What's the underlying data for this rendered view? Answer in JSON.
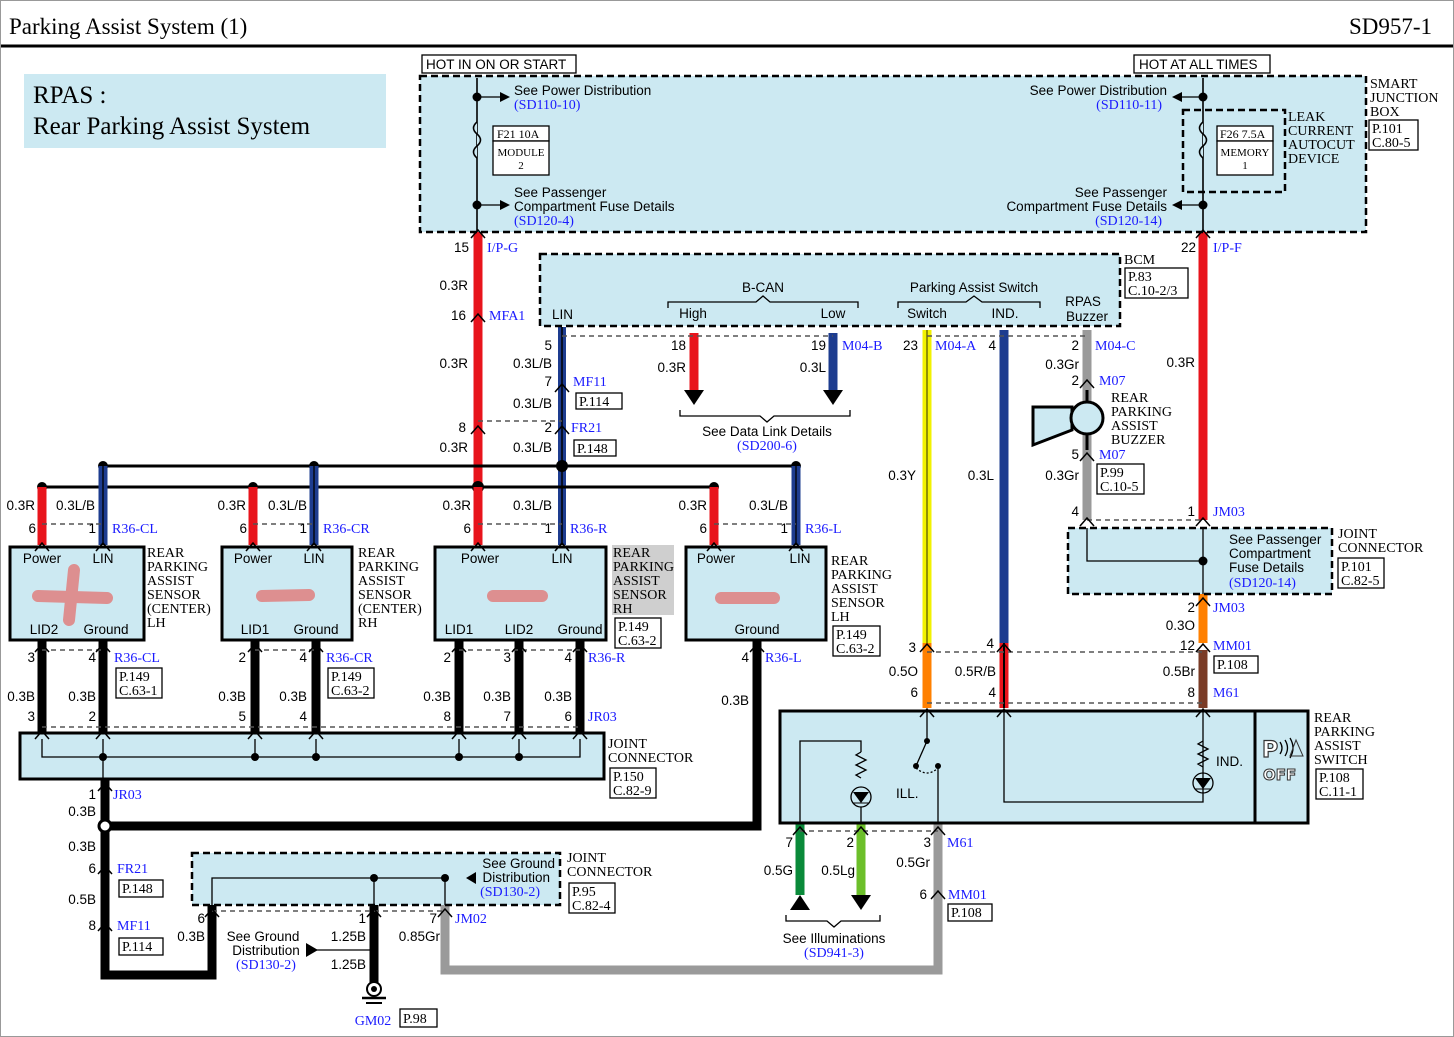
{
  "header": {
    "title": "Parking Assist System (1)",
    "code": "SD957-1"
  },
  "rpas": {
    "line1": "RPAS :",
    "line2": "Rear Parking Assist System"
  },
  "colors": {
    "red": "#e8141c",
    "blue": "#1d3c8f",
    "yellow": "#f2f200",
    "orange": "#ff8000",
    "brown": "#7a3b26",
    "gray": "#9a9a9a",
    "green": "#0a8a3a",
    "light_green": "#6cbf2a",
    "panel": "#cce9f2",
    "connector_text": "#1a1aff"
  },
  "sjb": {
    "hot_ign": "HOT IN ON OR START",
    "hot_all": "HOT AT ALL TIMES",
    "name": [
      "SMART",
      "JUNCTION",
      "BOX"
    ],
    "page": "P.101",
    "conn": "C.80-5",
    "leak": [
      "LEAK",
      "CURRENT",
      "AUTOCUT",
      "DEVICE"
    ],
    "f21": {
      "fuse": "F21 10A",
      "name1": "MODULE",
      "name2": "2"
    },
    "f26": {
      "fuse": "F26 7.5A",
      "name1": "MEMORY",
      "name2": "1"
    },
    "pd_left": "See Power Distribution",
    "pd_left_ref": "(SD110-10)",
    "pd_right": "See Power Distribution",
    "pd_right_ref": "(SD110-11)",
    "pcf_left": [
      "See Passenger",
      "Compartment Fuse Details",
      "(SD120-4)"
    ],
    "pcf_right": [
      "See Passenger",
      "Compartment Fuse Details",
      "(SD120-14)"
    ],
    "pin_left": "15",
    "conn_left": "I/P-G",
    "pin_right": "22",
    "conn_right": "I/P-F"
  },
  "bcm": {
    "name": "BCM",
    "page": "P.83",
    "conn": "C.10-2/3",
    "bcan": "B-CAN",
    "high": "High",
    "low": "Low",
    "lin": "LIN",
    "pas": "Parking Assist Switch",
    "switch": "Switch",
    "ind": "IND.",
    "rpas1": "RPAS",
    "rpas2": "Buzzer"
  },
  "red_main": {
    "w1": "0.3R",
    "p16": "16",
    "c16": "MFA1",
    "w2": "0.3R",
    "p8": "8",
    "w3": "0.3R"
  },
  "lin_main": {
    "p5": "5",
    "w1": "0.3L/B",
    "p7": "7",
    "c7": "MF11",
    "pg7": "P.114",
    "w2": "0.3L/B",
    "p2": "2",
    "c2": "FR21",
    "pg2": "P.148",
    "w3": "0.3L/B"
  },
  "datalink": {
    "p18": "18",
    "p19": "19",
    "conn": "M04-B",
    "w18": "0.3R",
    "w19": "0.3L",
    "text": "See Data Link Details",
    "ref": "(SD200-6)"
  },
  "pas_wires": {
    "p23": "23",
    "conn": "M04-A",
    "p4": "4",
    "wy": "0.3Y",
    "wl": "0.3L",
    "p3": "3",
    "p4b": "4",
    "wo": "0.5O",
    "wrb": "0.5R/B",
    "p6": "6",
    "p4c": "4"
  },
  "buzzer": {
    "p2": "2",
    "conn": "M04-C",
    "w1": "0.3Gr",
    "p2b": "2",
    "c2b": "M07",
    "name": [
      "REAR",
      "PARKING",
      "ASSIST",
      "BUZZER"
    ],
    "p5": "5",
    "c5": "M07",
    "w2": "0.3Gr",
    "page": "P.99",
    "pconn": "C.10-5",
    "p4": "4"
  },
  "right_red": {
    "w": "0.3R",
    "p1": "1",
    "c1": "JM03",
    "jc_text": [
      "See Passenger",
      "Compartment",
      "Fuse Details",
      "(SD120-14)"
    ],
    "jc_name": [
      "JOINT",
      "CONNECTOR"
    ],
    "jc_page": "P.101",
    "jc_conn": "C.82-5",
    "p2": "2",
    "c2": "JM03",
    "wo": "0.3O",
    "p12": "12",
    "c12": "MM01",
    "pg12": "P.108",
    "wbr": "0.5Br",
    "p8": "8",
    "c8": "M61"
  },
  "sensors": [
    {
      "name": [
        "REAR",
        "PARKING",
        "ASSIST",
        "SENSOR",
        "(CENTER)",
        "LH"
      ],
      "w_power": "0.3R",
      "w_lin": "0.3L/B",
      "p_power": "6",
      "p_lin": "1",
      "conn_top": "R36-CL",
      "power": "Power",
      "lin": "LIN",
      "lid": [
        "LID2"
      ],
      "ground": "Ground",
      "pins_bottom": [
        "3",
        "4"
      ],
      "conn_bottom": "R36-CL",
      "page": "P.149",
      "pconn": "C.63-1",
      "w_bottom": [
        "0.3B",
        "0.3B"
      ],
      "jr_pins": [
        "3",
        "2"
      ]
    },
    {
      "name": [
        "REAR",
        "PARKING",
        "ASSIST",
        "SENSOR",
        "(CENTER)",
        "RH"
      ],
      "w_power": "0.3R",
      "w_lin": "0.3L/B",
      "p_power": "6",
      "p_lin": "1",
      "conn_top": "R36-CR",
      "power": "Power",
      "lin": "LIN",
      "lid": [
        "LID1"
      ],
      "ground": "Ground",
      "pins_bottom": [
        "2",
        "4"
      ],
      "conn_bottom": "R36-CR",
      "page": "P.149",
      "pconn": "C.63-2",
      "w_bottom": [
        "0.3B",
        "0.3B"
      ],
      "jr_pins": [
        "5",
        "4"
      ]
    },
    {
      "name": [
        "REAR",
        "PARKING",
        "ASSIST",
        "SENSOR",
        "RH"
      ],
      "w_power": "0.3R",
      "w_lin": "0.3L/B",
      "p_power": "6",
      "p_lin": "1",
      "conn_top": "R36-R",
      "power": "Power",
      "lin": "LIN",
      "lid": [
        "LID1",
        "LID2"
      ],
      "ground": "Ground",
      "pins_bottom": [
        "2",
        "3",
        "4"
      ],
      "conn_bottom": "R36-R",
      "page": "P.149",
      "pconn": "C.63-2",
      "w_bottom": [
        "0.3B",
        "0.3B",
        "0.3B"
      ],
      "jr_pins": [
        "8",
        "7",
        "6"
      ],
      "jr_conn": "JR03"
    },
    {
      "name": [
        "REAR",
        "PARKING",
        "ASSIST",
        "SENSOR",
        "LH"
      ],
      "w_power": "0.3R",
      "w_lin": "0.3L/B",
      "p_power": "6",
      "p_lin": "1",
      "conn_top": "R36-L",
      "power": "Power",
      "lin": "LIN",
      "ground": "Ground",
      "pins_bottom": [
        "4"
      ],
      "conn_bottom": "R36-L",
      "page": "P.149",
      "pconn": "C.63-2",
      "w_bottom": [
        "0.3B"
      ]
    }
  ],
  "jr03": {
    "name": [
      "JOINT",
      "CONNECTOR"
    ],
    "page": "P.150",
    "conn": "C.82-9",
    "p1": "1",
    "c1": "JR03",
    "w1": "0.3B",
    "w2": "0.3B",
    "p6": "6",
    "c6": "FR21",
    "pg6": "P.148",
    "w3": "0.5B",
    "p8": "8",
    "c8": "MF11",
    "pg8": "P.114"
  },
  "ground": {
    "jc_text": [
      "See Ground",
      "Distribution",
      "(SD130-2)"
    ],
    "jc_name": [
      "JOINT",
      "CONNECTOR"
    ],
    "jc_page": "P.95",
    "jc_conn": "C.82-4",
    "p6": "6",
    "w6": "0.3B",
    "p1": "1",
    "w1": "1.25B",
    "p7": "7",
    "c7": "JM02",
    "w7": "0.85Gr",
    "see": [
      "See Ground",
      "Distribution",
      "(SD130-2)"
    ],
    "w_gnd": "1.25B",
    "gnd": "GM02",
    "gnd_page": "P.98"
  },
  "switch": {
    "name": [
      "REAR",
      "PARKING",
      "ASSIST",
      "SWITCH"
    ],
    "page": "P.108",
    "conn": "C.11-1",
    "ill": "ILL.",
    "ind": "IND.",
    "icon_text": "OFF",
    "p7": "7",
    "p2": "2",
    "p3": "3",
    "c3": "M61",
    "wg": "0.5G",
    "wlg": "0.5Lg",
    "wgr": "0.5Gr",
    "p6": "6",
    "c6": "MM01",
    "pg6": "P.108",
    "illum": "See Illuminations",
    "illum_ref": "(SD941-3)"
  }
}
